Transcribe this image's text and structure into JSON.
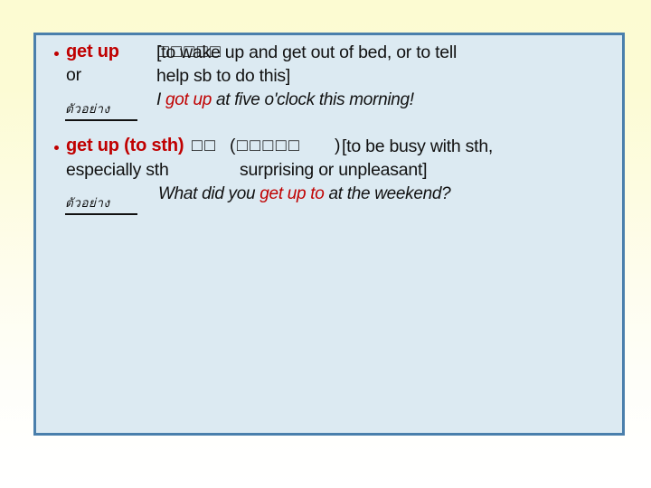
{
  "slide": {
    "background_top_color": "#fcfbd2",
    "background_bottom_color": "#ffffff",
    "content_box": {
      "fill_color": "#dceaf2",
      "border_color": "#4a7fac"
    },
    "accent_color": "#c00000",
    "text_color": "#111111"
  },
  "entries": [
    {
      "bullet": "•",
      "headword": "get up",
      "connector": "or",
      "missing_glyphs_1": "□□□□□",
      "definition_line1": "[to wake up and get out of bed, or to tell",
      "definition_line2": "help sb to do this]",
      "example_label": "ตัวอย่าง",
      "example_prefix": "I ",
      "example_highlight": "got up",
      "example_suffix": " at five o'clock this morning!"
    },
    {
      "bullet": "•",
      "headword": "get up (to sth)",
      "missing_glyphs_1": "□□",
      "paren_open": "(",
      "missing_glyphs_2": "□□□□□",
      "paren_close": ")",
      "definition_line1": "[to be busy with sth,",
      "definition_line2_left": "especially sth",
      "definition_line2_right": "surprising or unpleasant]",
      "example_label": "ตัวอย่าง",
      "example_prefix": "What did you ",
      "example_highlight": "get up to",
      "example_suffix": " at the weekend?"
    }
  ]
}
